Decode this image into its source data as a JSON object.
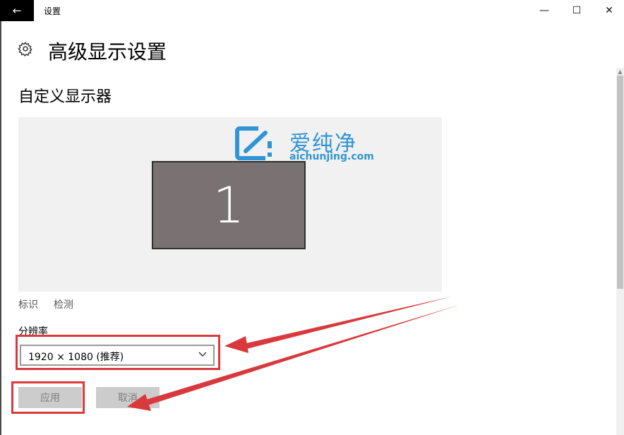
{
  "window": {
    "back_glyph": "←",
    "title": "设置",
    "minimize_glyph": "—",
    "maximize_glyph": "☐",
    "close_glyph": "✕"
  },
  "header": {
    "icon": "gear-icon",
    "title": "高级显示设置"
  },
  "section": {
    "title": "自定义显示器"
  },
  "preview": {
    "monitor_number": "1"
  },
  "watermark": {
    "text": "爱纯净",
    "url": "aichunjing.com",
    "color": "#2f95d4"
  },
  "links": {
    "identify": "标识",
    "detect": "检测"
  },
  "resolution": {
    "label": "分辨率",
    "value": "1920 × 1080 (推荐)"
  },
  "buttons": {
    "apply": "应用",
    "cancel": "取消"
  },
  "annotation": {
    "color": "#d9393c"
  }
}
